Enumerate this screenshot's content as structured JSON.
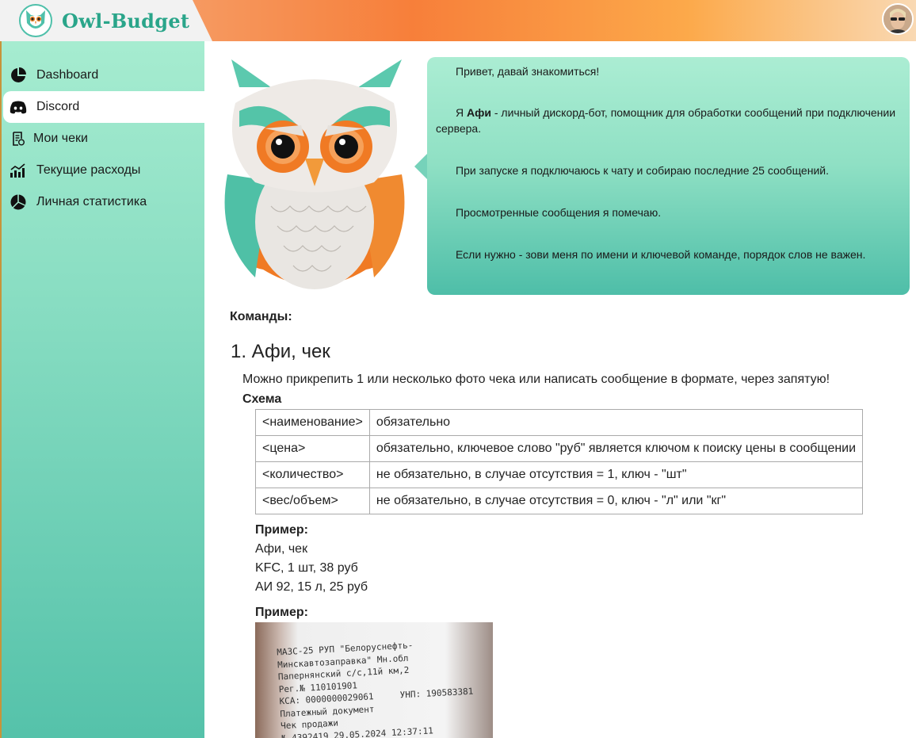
{
  "header": {
    "brand": "Owl-Budget",
    "logo_icon": "owl-logo-icon",
    "avatar_icon": "user-avatar"
  },
  "sidebar": {
    "items": [
      {
        "label": "Dashboard",
        "icon": "pie-chart-icon"
      },
      {
        "label": "Discord",
        "icon": "discord-icon",
        "active": true
      },
      {
        "label": "Мои чеки",
        "icon": "receipt-icon"
      },
      {
        "label": "Текущие расходы",
        "icon": "bar-chart-icon"
      },
      {
        "label": "Личная статистика",
        "icon": "pie-chart-icon"
      }
    ]
  },
  "intro": {
    "greeting": "Привет, давай знакомиться!",
    "p2_prefix": "Я ",
    "p2_bold": "Афи",
    "p2_suffix": " - личный дискорд-бот, помощник для обработки сообщений при подключении сервера.",
    "p3": "При запуске я подключаюсь к чату и собираю последние 25 сообщений.",
    "p4": "Просмотренные сообщения я помечаю.",
    "p5": "Если нужно - зови меня по имени и ключевой команде, порядок слов не важен."
  },
  "commands": {
    "title": "Команды:",
    "cmd1": {
      "heading": "1. Афи, чек",
      "description": "Можно прикрепить 1 или несколько фото чека или написать сообщение в формате, через запятую!",
      "schema_title": "Схема",
      "schema": [
        {
          "key": "<наименование>",
          "value": "обязательно"
        },
        {
          "key": "<цена>",
          "value": "обязательно, ключевое слово \"руб\" является ключом к поиску цены в сообщении"
        },
        {
          "key": "<количество>",
          "value": "не обязательно, в случае отсутствия = 1, ключ - \"шт\""
        },
        {
          "key": "<вес/объем>",
          "value": "не обязательно, в случае отсутствия = 0, ключ - \"л\" или \"кг\""
        }
      ],
      "example_title": "Пример:",
      "example_lines": [
        "Афи, чек",
        "KFC, 1 шт, 38 руб",
        "АИ 92, 15 л, 25 руб"
      ],
      "example2_title": "Пример:"
    }
  },
  "receipt_photo": {
    "lines": [
      "МАЗС-25 РУП \"Белоруснефть-",
      "Минскавтозаправка\" Мн.обл",
      "Папернянский с/с,11й км,2",
      "Рег.№ 110101901",
      "КСА: 0000000029061     УНП: 190583381",
      "Платежный документ",
      "Чек продажи",
      "№ 4392419 29.05.2024 12:37:11"
    ]
  }
}
